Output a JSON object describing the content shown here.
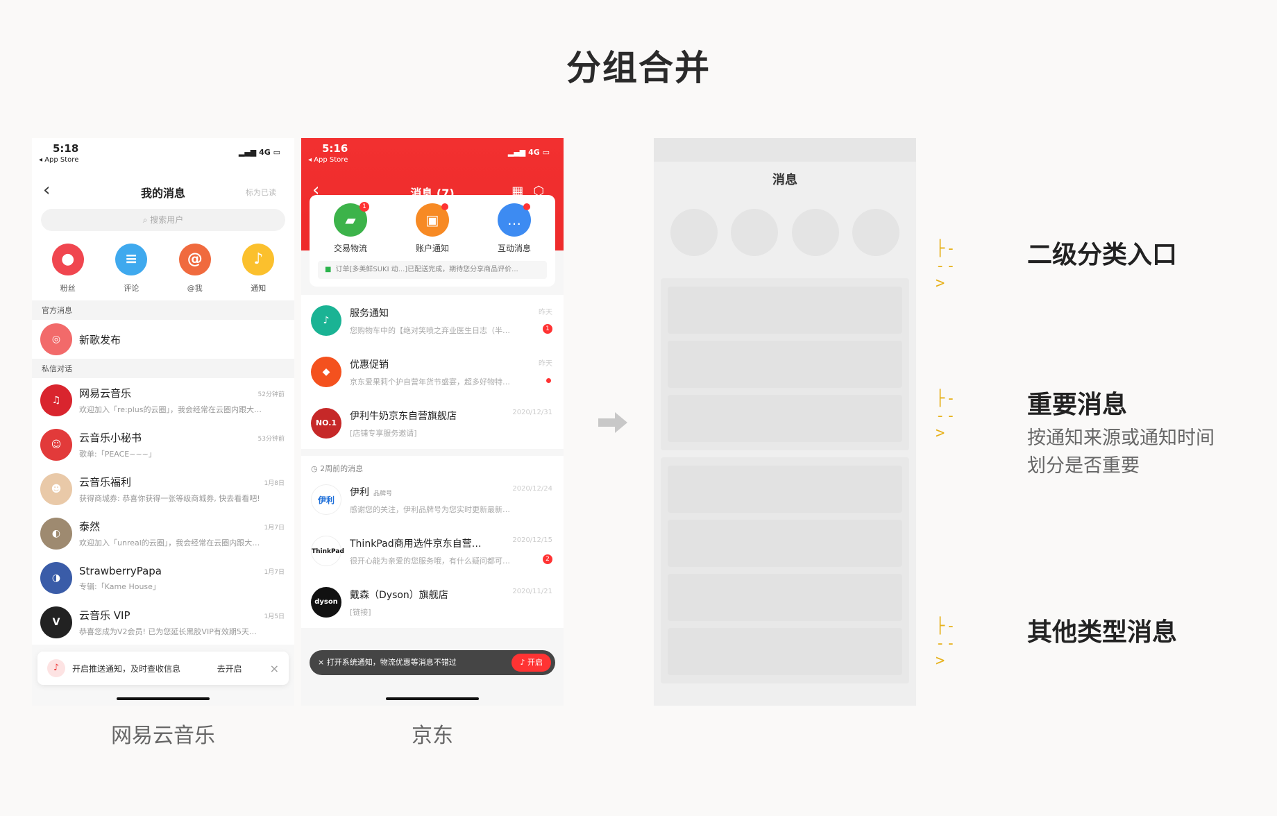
{
  "title": "分组合并",
  "netease": {
    "caption": "网易云音乐",
    "time": "5:18",
    "back_app": "◂ App Store",
    "signal": "4G",
    "nav_title": "我的消息",
    "mark_read": "标为已读",
    "search_placeholder": "搜索用户",
    "categories": [
      {
        "label": "粉丝",
        "icon": "person-icon",
        "color": "#f0464f"
      },
      {
        "label": "评论",
        "icon": "chat-icon",
        "color": "#3fa9ee"
      },
      {
        "label": "@我",
        "icon": "at-icon",
        "color": "#f06a3e"
      },
      {
        "label": "通知",
        "icon": "bell-icon",
        "color": "#fbc02d"
      }
    ],
    "section_official": "官方消息",
    "official": {
      "name": "新歌发布"
    },
    "section_private": "私信对话",
    "conversations": [
      {
        "name": "网易云音乐",
        "sub": "欢迎加入「re:plus的云圈」，我会经常在云圈内跟大…",
        "time": "52分钟前",
        "color": "#d9252e"
      },
      {
        "name": "云音乐小秘书",
        "sub": "歌单:「PEACE~~~」",
        "time": "53分钟前",
        "color": "#e23a3a"
      },
      {
        "name": "云音乐福利",
        "sub": "获得商城券: 恭喜你获得一张等级商城券, 快去看看吧!",
        "time": "1月8日",
        "color": "#e9c9a8"
      },
      {
        "name": "泰然",
        "sub": "欢迎加入「unreal的云圈」，我会经常在云圈内跟大…",
        "time": "1月7日",
        "color": "#9e8a70"
      },
      {
        "name": "StrawberryPapa",
        "sub": "专辑:「Kame House」",
        "time": "1月7日",
        "color": "#3a5ca8"
      },
      {
        "name": "云音乐 VIP",
        "sub": "恭喜您成为V2会员! 已为您延长黑胶VIP有效期5天…",
        "time": "1月5日",
        "color": "#222222"
      }
    ],
    "push_text": "开启推送通知，及时查收信息",
    "push_action": "去开启"
  },
  "jd": {
    "caption": "京东",
    "time": "5:16",
    "back_app": "◂ App Store",
    "signal": "4G",
    "nav_title": "消息 (7)",
    "categories": [
      {
        "label": "交易物流",
        "color": "#3cb34a",
        "badge": "1"
      },
      {
        "label": "账户通知",
        "color": "#f78a24"
      },
      {
        "label": "互动消息",
        "color": "#3d8bf2"
      }
    ],
    "note": "订单[多美鲜SUKI 动...]已配送完成，期待您分享商品评价...",
    "important": [
      {
        "name": "服务通知",
        "sub": "您购物车中的【绝对笑喷之弃业医生日志（半…",
        "time": "昨天",
        "badge": "1",
        "color": "#1ab394"
      },
      {
        "name": "优惠促销",
        "sub": "京东爱果莉个护自营年货节盛宴，超多好物特…",
        "time": "昨天",
        "color": "#f4511e"
      },
      {
        "name": "伊利牛奶京东自营旗舰店",
        "sub": "[店铺专享服务邀请]",
        "time": "2020/12/31",
        "color": "#c62828",
        "ava_text": "NO.1"
      }
    ],
    "ago_label": "2周前的消息",
    "others": [
      {
        "name": "伊利",
        "tag": "品牌号",
        "sub": "感谢您的关注，伊利品牌号为您实时更新最新…",
        "time": "2020/12/24",
        "color": "#1e6fd9",
        "ava_text": "伊利"
      },
      {
        "name": "ThinkPad商用选件京东自营…",
        "sub": "很开心能为亲爱的您服务哦，有什么疑问都可…",
        "time": "2020/12/15",
        "badge": "2",
        "color": "#111111",
        "ava_text": "ThinkPad"
      },
      {
        "name": "戴森（Dyson）旗舰店",
        "sub": "[链接]",
        "time": "2020/11/21",
        "color": "#111111",
        "ava_text": "dyson"
      }
    ],
    "toast": "× 打开系统通知，物流优惠等消息不错过",
    "toast_action": "开启"
  },
  "wire": {
    "title": "消息"
  },
  "annotations": [
    {
      "label": "二级分类入口",
      "desc1": "",
      "desc2": ""
    },
    {
      "label": "重要消息",
      "desc1": "按通知来源或通知时间",
      "desc2": "划分是否重要"
    },
    {
      "label": "其他类型消息",
      "desc1": "",
      "desc2": ""
    }
  ],
  "accent": "#e7b21d"
}
